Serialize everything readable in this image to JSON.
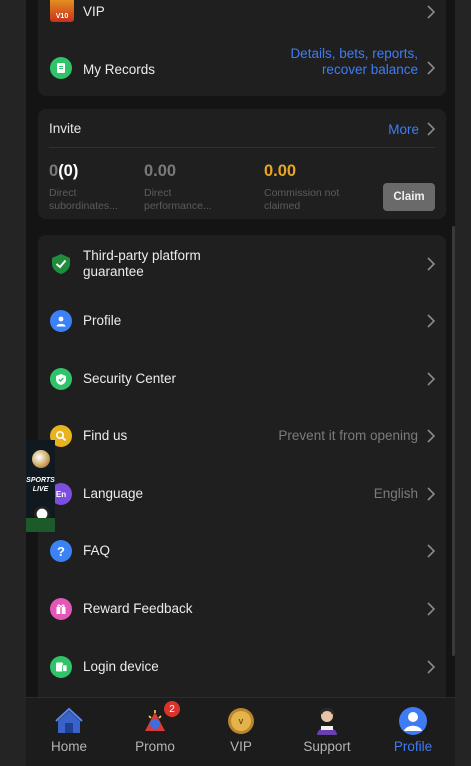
{
  "top_card": {
    "vip_label": "VIP",
    "vip_badge": "V10",
    "records_label": "My Records",
    "records_value_line1": "Details, bets, reports,",
    "records_value_line2": "recover balance"
  },
  "invite": {
    "title": "Invite",
    "more": "More",
    "stats": [
      {
        "value": "0",
        "value_bold": "(0)",
        "label_line1": "Direct",
        "label_line2": "subordinates..."
      },
      {
        "value": "0.00",
        "label_line1": "Direct",
        "label_line2": "performance..."
      },
      {
        "value": "0.00",
        "label_line1": "Commission not",
        "label_line2": "claimed"
      }
    ],
    "claim_button": "Claim"
  },
  "menu": {
    "items": [
      {
        "label_line1": "Third-party platform",
        "label_line2": "guarantee",
        "value": "",
        "icon": "shield-check-icon"
      },
      {
        "label": "Profile",
        "value": "",
        "icon": "user-icon"
      },
      {
        "label": "Security Center",
        "value": "",
        "icon": "shield-icon"
      },
      {
        "label": "Find us",
        "value": "Prevent it from opening",
        "icon": "search-icon"
      },
      {
        "label": "Language",
        "value": "English",
        "icon": "language-icon",
        "icon_text": "En"
      },
      {
        "label": "FAQ",
        "value": "",
        "icon": "question-icon",
        "icon_text": "?"
      },
      {
        "label": "Reward Feedback",
        "value": "",
        "icon": "gift-icon"
      },
      {
        "label": "Login device",
        "value": "",
        "icon": "device-icon"
      }
    ]
  },
  "floating_ad": {
    "line1": "SPORTS",
    "line2": "LIVE"
  },
  "nav": {
    "items": [
      {
        "label": "Home",
        "icon": "home-icon"
      },
      {
        "label": "Promo",
        "icon": "promo-icon",
        "badge": "2"
      },
      {
        "label": "VIP",
        "icon": "vip-icon"
      },
      {
        "label": "Support",
        "icon": "support-icon"
      },
      {
        "label": "Profile",
        "icon": "profile-icon",
        "active": true
      }
    ]
  },
  "colors": {
    "accent": "#3f7cf4",
    "gold": "#e9a623",
    "background": "#141414",
    "card": "#1f1f1f"
  }
}
